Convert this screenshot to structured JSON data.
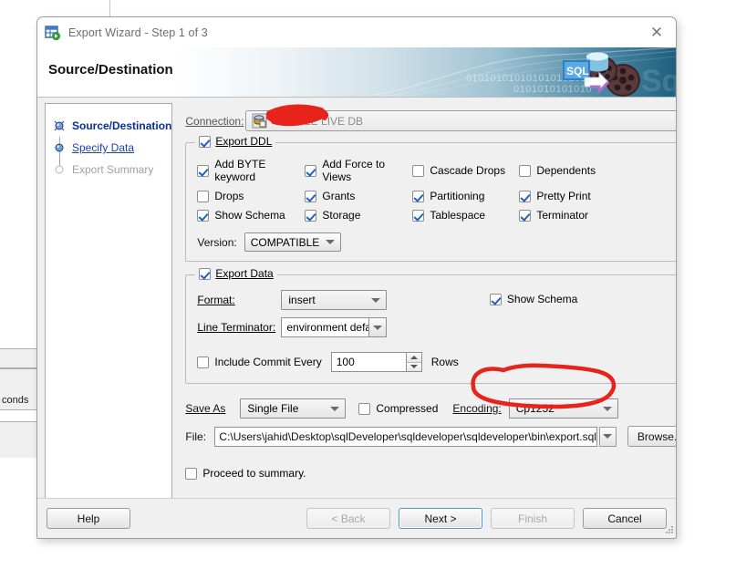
{
  "window": {
    "title": "Export Wizard - Step 1 of 3",
    "icon": "export-table-icon",
    "close_label": "✕"
  },
  "banner": {
    "heading": "Source/Destination",
    "binary_line_1": "010101010101010101010101010",
    "binary_line_2": "0101010101010",
    "art_label": "SQL"
  },
  "sidebar": {
    "items": [
      {
        "label": "Source/Destination",
        "state": "current"
      },
      {
        "label": "Specify Data",
        "state": "link"
      },
      {
        "label": "Export Summary",
        "state": "disabled"
      }
    ]
  },
  "connection": {
    "label": "Connection:",
    "value": "ORACLE LIVE DB",
    "icon": "database-connection-icon"
  },
  "export_ddl": {
    "title": "Export DDL",
    "checked": true,
    "options": [
      {
        "label": "Add BYTE keyword",
        "checked": true
      },
      {
        "label": "Add Force to Views",
        "checked": true
      },
      {
        "label": "Cascade Drops",
        "checked": false
      },
      {
        "label": "Dependents",
        "checked": false
      },
      {
        "label": "Drops",
        "checked": false
      },
      {
        "label": "Grants",
        "checked": true
      },
      {
        "label": "Partitioning",
        "checked": true
      },
      {
        "label": "Pretty Print",
        "checked": true
      },
      {
        "label": "Show Schema",
        "checked": true
      },
      {
        "label": "Storage",
        "checked": true
      },
      {
        "label": "Tablespace",
        "checked": true
      },
      {
        "label": "Terminator",
        "checked": true
      }
    ],
    "version_label": "Version:",
    "version_value": "COMPATIBLE"
  },
  "export_data": {
    "title": "Export Data",
    "checked": true,
    "format_label": "Format:",
    "format_value": "insert",
    "line_terminator_label": "Line Terminator:",
    "line_terminator_value": "environment default",
    "show_schema_label": "Show Schema",
    "show_schema_checked": true,
    "commit_label": "Include Commit Every",
    "commit_checked": false,
    "commit_value": "100",
    "rows_label": "Rows"
  },
  "save": {
    "save_as_label": "Save As",
    "save_as_value": "Single File",
    "compressed_label": "Compressed",
    "compressed_checked": false,
    "encoding_label": "Encoding:",
    "encoding_value": "Cp1252",
    "file_label": "File:",
    "file_value": "C:\\Users\\jahid\\Desktop\\sqlDeveloper\\sqldeveloper\\sqldeveloper\\bin\\export.sql",
    "browse_label": "Browse..."
  },
  "proceed": {
    "label": "Proceed to summary.",
    "checked": false
  },
  "footer": {
    "help": "Help",
    "back": "< Back",
    "next": "Next >",
    "finish": "Finish",
    "cancel": "Cancel"
  },
  "background": {
    "text": "conds"
  },
  "annotations": {
    "scribble_color": "#e8231c",
    "ellipse_color": "#e8231c"
  }
}
